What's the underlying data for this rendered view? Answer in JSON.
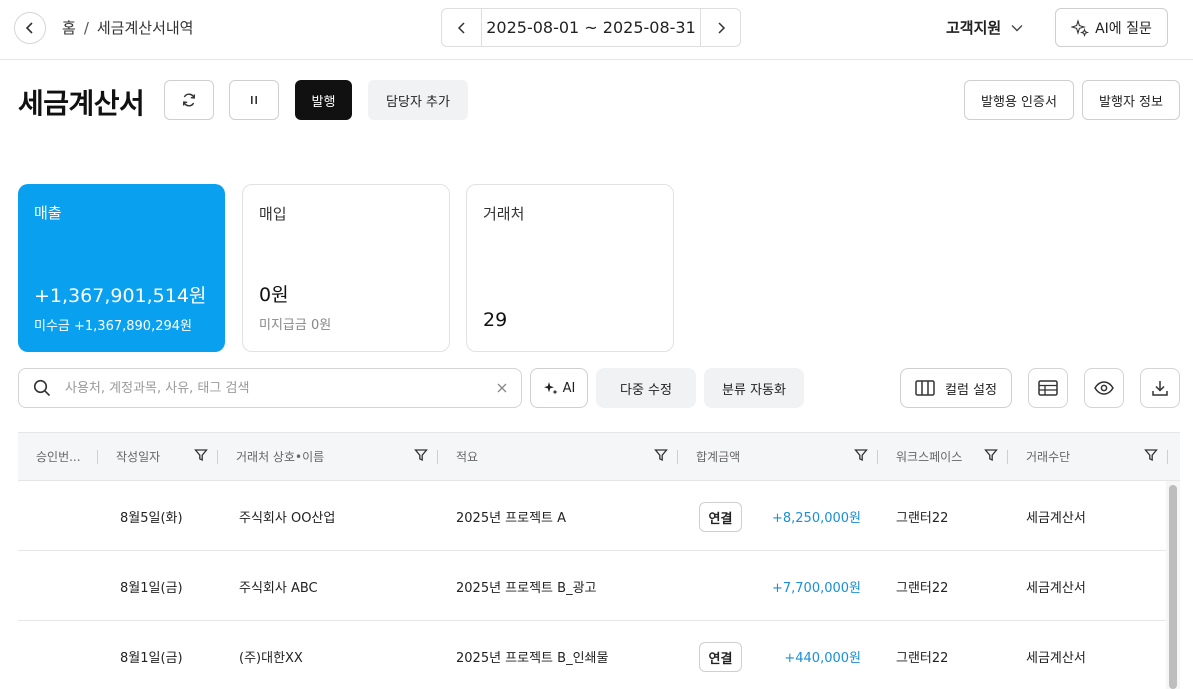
{
  "breadcrumb": {
    "home": "홈",
    "separator": "/",
    "current": "세금계산서내역"
  },
  "date_range": {
    "text": "2025-08-01 ~ 2025-08-31"
  },
  "header": {
    "support_label": "고객지원",
    "ai_ask_label": "AI에 질문"
  },
  "page": {
    "title": "세금계산서",
    "issue_label": "발행",
    "add_manager_label": "담당자 추가",
    "cert_label": "발행용 인증서",
    "issuer_info_label": "발행자 정보"
  },
  "cards": {
    "sales": {
      "title": "매출",
      "amount": "+1,367,901,514원",
      "sub": "미수금 +1,367,890,294원"
    },
    "purchase": {
      "title": "매입",
      "amount": "0원",
      "sub": "미지급금 0원"
    },
    "partners": {
      "title": "거래처",
      "count": "29"
    }
  },
  "toolbar": {
    "search_placeholder": "사용처, 계정과목, 사유, 태그 검색",
    "ai_label": "AI",
    "bulk_edit_label": "다중 수정",
    "auto_classify_label": "분류 자동화",
    "column_settings_label": "컬럼 설정"
  },
  "table": {
    "columns": [
      "승인번...",
      "작성일자",
      "거래처 상호•이름",
      "적요",
      "합계금액",
      "워크스페이스",
      "거래수단"
    ],
    "link_label": "연결",
    "rows": [
      {
        "approval": "",
        "date": "8월5일(화)",
        "partner": "주식회사 OO산업",
        "memo": "2025년 프로젝트 A",
        "linked": true,
        "amount": "+8,250,000원",
        "workspace": "그랜터22",
        "method": "세금계산서"
      },
      {
        "approval": "",
        "date": "8월1일(금)",
        "partner": "주식회사 ABC",
        "memo": "2025년 프로젝트 B_광고",
        "linked": false,
        "amount": "+7,700,000원",
        "workspace": "그랜터22",
        "method": "세금계산서"
      },
      {
        "approval": "",
        "date": "8월1일(금)",
        "partner": "(주)대한XX",
        "memo": "2025년 프로젝트 B_인쇄물",
        "linked": true,
        "amount": "+440,000원",
        "workspace": "그랜터22",
        "method": "세금계산서"
      }
    ]
  },
  "colors": {
    "accent": "#0aa0f0",
    "amount": "#1a8fd6"
  },
  "icons": [
    "chevron-left-icon",
    "chevron-right-icon",
    "chevron-down-icon",
    "sparkle-icon",
    "refresh-icon",
    "pause-icon",
    "search-icon",
    "clear-icon",
    "columns-icon",
    "table-icon",
    "eye-icon",
    "download-icon",
    "filter-icon"
  ]
}
